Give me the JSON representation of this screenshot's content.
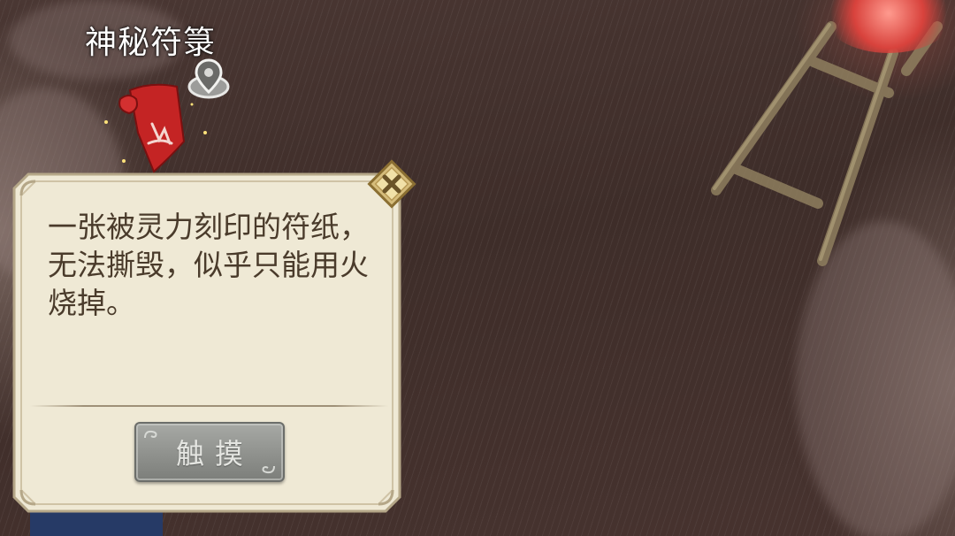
{
  "scene": {
    "location_label": "神秘符箓"
  },
  "info_panel": {
    "description": "一张被灵力刻印的符纸，无法撕毁，似乎只能用火烧掉。",
    "action_button_label": "触摸"
  },
  "icons": {
    "location_marker": "location-pin-icon",
    "item": "red-talisman-scroll-icon",
    "close": "close-x-icon"
  },
  "colors": {
    "panel_background": "#efe9d5",
    "panel_border": "#b5a788",
    "panel_text": "#4a3b2b",
    "button_gray": "#8f918d",
    "close_gold": "#d6bd7c",
    "scroll_red": "#c42424"
  }
}
